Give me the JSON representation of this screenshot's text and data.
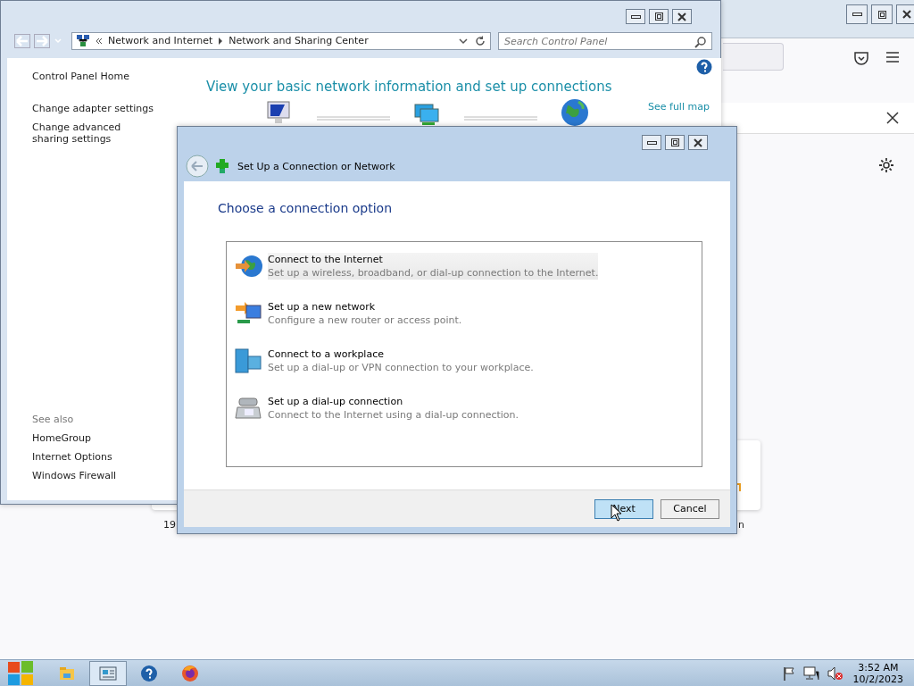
{
  "browser_window": {
    "fragments": [
      {
        "text": "19"
      },
      {
        "text": "n"
      }
    ]
  },
  "control_panel": {
    "breadcrumbs": [
      "Network and Internet",
      "Network and Sharing Center"
    ],
    "search": {
      "placeholder": "Search Control Panel"
    },
    "sidebar": {
      "items": [
        "Control Panel Home",
        "Change adapter settings",
        "Change advanced sharing settings"
      ],
      "see_also_title": "See also",
      "see_also": [
        "HomeGroup",
        "Internet Options",
        "Windows Firewall"
      ]
    },
    "heading": "View your basic network information and set up connections",
    "map_link": "See full map"
  },
  "dialog": {
    "title": "Set Up a Connection or Network",
    "heading": "Choose a connection option",
    "options": [
      {
        "kind": "internet",
        "title": "Connect to the Internet",
        "description": "Set up a wireless, broadband, or dial-up connection to the Internet.",
        "selected": true
      },
      {
        "kind": "network",
        "title": "Set up a new network",
        "description": "Configure a new router or access point.",
        "selected": false
      },
      {
        "kind": "workplace",
        "title": "Connect to a workplace",
        "description": "Set up a dial-up or VPN connection to your workplace.",
        "selected": false
      },
      {
        "kind": "dialup",
        "title": "Set up a dial-up connection",
        "description": "Connect to the Internet using a dial-up connection.",
        "selected": false
      }
    ],
    "buttons": [
      {
        "label": "Next",
        "selected": true
      },
      {
        "label": "Cancel",
        "selected": false
      }
    ]
  },
  "taskbar": {
    "apps": [
      {
        "kind": "explorer",
        "selected": false
      },
      {
        "kind": "control",
        "selected": true
      },
      {
        "kind": "help",
        "selected": false
      },
      {
        "kind": "firefox",
        "selected": false
      }
    ],
    "clock": {
      "time": "3:52 AM",
      "date": "10/2/2023"
    }
  }
}
